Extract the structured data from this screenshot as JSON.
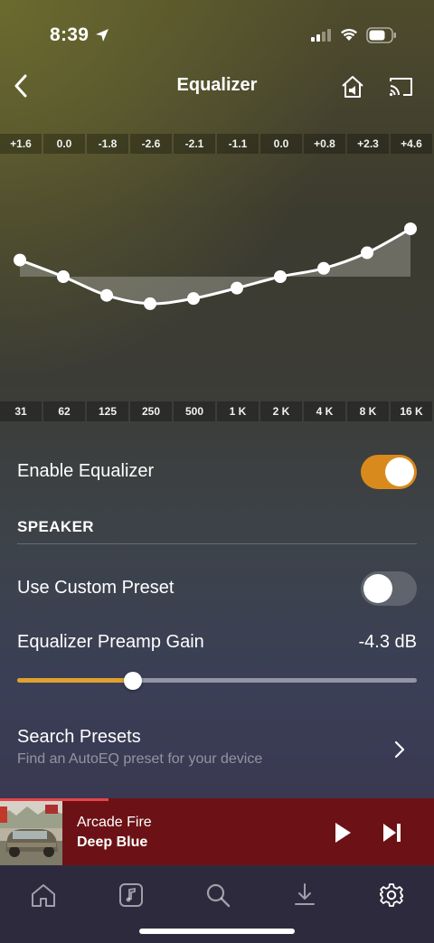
{
  "status_bar": {
    "time": "8:39"
  },
  "nav": {
    "title": "Equalizer"
  },
  "equalizer": {
    "gains_db": [
      "+1.6",
      "0.0",
      "-1.8",
      "-2.6",
      "-2.1",
      "-1.1",
      "0.0",
      "+0.8",
      "+2.3",
      "+4.6"
    ],
    "frequencies": [
      "31",
      "62",
      "125",
      "250",
      "500",
      "1 K",
      "2 K",
      "4 K",
      "8 K",
      "16 K"
    ]
  },
  "settings": {
    "enable_equalizer_label": "Enable Equalizer",
    "enable_equalizer_on": true,
    "section_speaker": "SPEAKER",
    "custom_preset_label": "Use Custom Preset",
    "custom_preset_on": false,
    "preamp_label": "Equalizer Preamp Gain",
    "preamp_value": "-4.3 dB",
    "preamp_slider_fraction": 0.29,
    "search_presets_title": "Search Presets",
    "search_presets_subtitle": "Find an AutoEQ preset for your device"
  },
  "now_playing": {
    "artist": "Arcade Fire",
    "title": "Deep Blue",
    "progress_fraction": 0.25
  },
  "colors": {
    "accent": "#d98a1c",
    "slider_fill": "#e0a12d",
    "mini_player_bg": "#6c1216",
    "progress": "#e8434a"
  },
  "tabs": [
    "home-icon",
    "music-note-icon",
    "search-icon",
    "download-icon",
    "gear-icon"
  ]
}
